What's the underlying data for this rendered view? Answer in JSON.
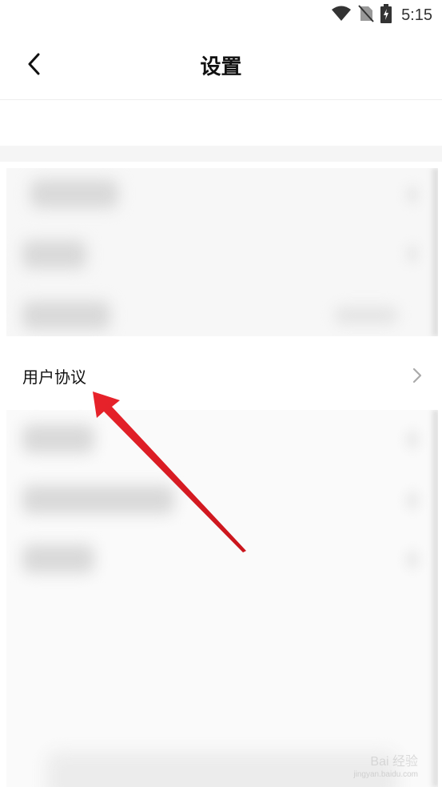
{
  "status_bar": {
    "time": "5:15",
    "icons": [
      "wifi-icon",
      "no-sim-icon",
      "battery-charging-icon"
    ]
  },
  "header": {
    "title": "设置",
    "back_icon": "chevron-left-icon"
  },
  "settings": {
    "highlighted_item": {
      "label": "用户协议",
      "icon": "chevron-right-icon"
    }
  },
  "annotation": {
    "arrow_color": "#e8232b"
  },
  "watermark": {
    "text": "Bai 经验",
    "url": "jingyan.baidu.com"
  }
}
